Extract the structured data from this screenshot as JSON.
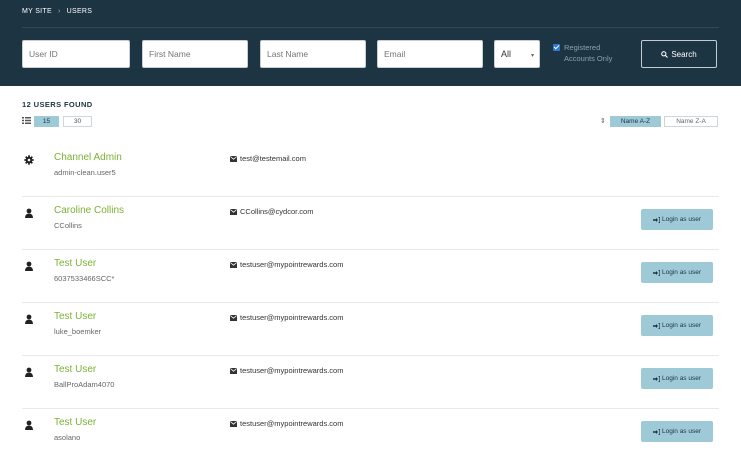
{
  "breadcrumb": {
    "site": "MY SITE",
    "separator": "›",
    "current": "USERS"
  },
  "filters": {
    "user_id_placeholder": "User ID",
    "first_name_placeholder": "First Name",
    "last_name_placeholder": "Last Name",
    "email_placeholder": "Email",
    "status_select": "All",
    "registered_label": "Registered Accounts Only",
    "registered_checked": true,
    "search_label": "Search"
  },
  "results": {
    "found_label": "12 USERS FOUND",
    "page_sizes": [
      "15",
      "30"
    ],
    "active_page_size": "15",
    "sort_options": [
      "Name A-Z",
      "Name Z-A"
    ],
    "active_sort": "Name A-Z"
  },
  "users": [
    {
      "name": "Channel Admin",
      "username": "admin-clean.user5",
      "email": "test@testemail.com",
      "icon": "gear-icon",
      "has_login": false
    },
    {
      "name": "Caroline Collins",
      "username": "CCollins",
      "email": "CCollins@cydcor.com",
      "icon": "user-icon",
      "has_login": true
    },
    {
      "name": "Test User",
      "username": "6037533466SCC*",
      "email": "testuser@mypointrewards.com",
      "icon": "user-icon",
      "has_login": true
    },
    {
      "name": "Test User",
      "username": "luke_boemker",
      "email": "testuser@mypointrewards.com",
      "icon": "user-icon",
      "has_login": true
    },
    {
      "name": "Test User",
      "username": "BallProAdam4070",
      "email": "testuser@mypointrewards.com",
      "icon": "user-icon",
      "has_login": true
    },
    {
      "name": "Test User",
      "username": "asolano",
      "email": "testuser@mypointrewards.com",
      "icon": "user-icon",
      "has_login": true
    }
  ],
  "login_label": "Login as user",
  "colors": {
    "header_bg": "#1d3443",
    "accent": "#9ec9d6",
    "name_green": "#7ab233"
  }
}
